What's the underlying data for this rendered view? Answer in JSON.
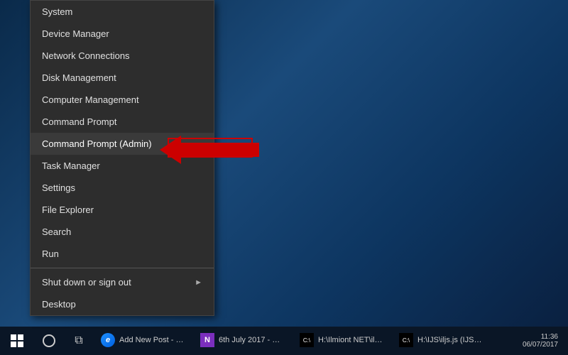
{
  "desktop": {
    "background": "Windows 10 dark blue desktop"
  },
  "contextMenu": {
    "items": [
      {
        "id": "system",
        "label": "System",
        "hasArrow": false,
        "highlighted": false,
        "separator_after": false
      },
      {
        "id": "device-manager",
        "label": "Device Manager",
        "hasArrow": false,
        "highlighted": false,
        "separator_after": false
      },
      {
        "id": "network-connections",
        "label": "Network Connections",
        "hasArrow": false,
        "highlighted": false,
        "separator_after": false
      },
      {
        "id": "disk-management",
        "label": "Disk Management",
        "hasArrow": false,
        "highlighted": false,
        "separator_after": false
      },
      {
        "id": "computer-management",
        "label": "Computer Management",
        "hasArrow": false,
        "highlighted": false,
        "separator_after": false
      },
      {
        "id": "command-prompt",
        "label": "Command Prompt",
        "hasArrow": false,
        "highlighted": false,
        "separator_after": false
      },
      {
        "id": "command-prompt-admin",
        "label": "Command Prompt (Admin)",
        "hasArrow": false,
        "highlighted": true,
        "separator_after": false
      },
      {
        "id": "task-manager",
        "label": "Task Manager",
        "hasArrow": false,
        "highlighted": false,
        "separator_after": false
      },
      {
        "id": "settings",
        "label": "Settings",
        "hasArrow": false,
        "highlighted": false,
        "separator_after": false
      },
      {
        "id": "file-explorer",
        "label": "File Explorer",
        "hasArrow": false,
        "highlighted": false,
        "separator_after": false
      },
      {
        "id": "search",
        "label": "Search",
        "hasArrow": false,
        "highlighted": false,
        "separator_after": false
      },
      {
        "id": "run",
        "label": "Run",
        "hasArrow": false,
        "highlighted": false,
        "separator_after": true
      },
      {
        "id": "shut-down",
        "label": "Shut down or sign out",
        "hasArrow": true,
        "highlighted": false,
        "separator_after": false
      },
      {
        "id": "desktop",
        "label": "Desktop",
        "hasArrow": false,
        "highlighted": false,
        "separator_after": false
      }
    ]
  },
  "taskbar": {
    "items": [
      {
        "id": "edge",
        "label": "Add New Post - One...",
        "iconType": "edge"
      },
      {
        "id": "onenote",
        "label": "6th July 2017 - One...",
        "iconType": "onenote"
      },
      {
        "id": "cmd1",
        "label": "H:\\Ilmiont NET\\ilm...",
        "iconType": "cmd"
      },
      {
        "id": "cmd2",
        "label": "H:\\IJS\\iljs.js (IJS) - ...",
        "iconType": "cmd"
      }
    ],
    "time": "11:36",
    "date": "06/07/2017"
  }
}
